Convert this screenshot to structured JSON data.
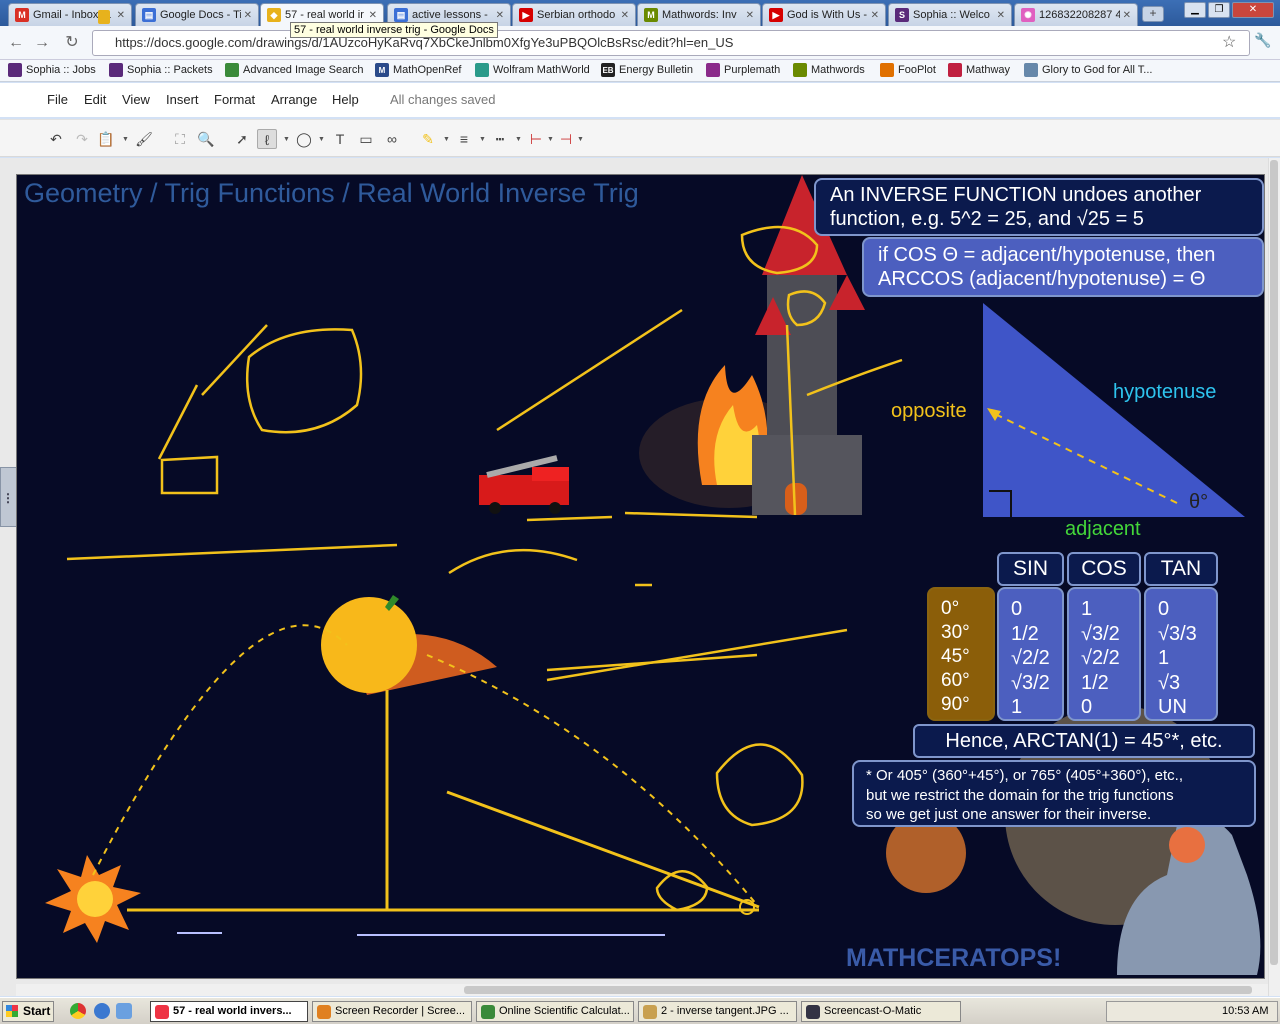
{
  "browser": {
    "tabs": [
      {
        "label": "Gmail - Inbox (1",
        "color": "#d93025",
        "glyph": "M"
      },
      {
        "label": "Google Docs - Ti",
        "color": "#3b6fd6",
        "glyph": "▤"
      },
      {
        "label": "57 - real world ir",
        "color": "#e8b21c",
        "glyph": "◆",
        "active": true
      },
      {
        "label": "active lessons -",
        "color": "#3b6fd6",
        "glyph": "▤"
      },
      {
        "label": "Serbian orthodo",
        "color": "#d60000",
        "glyph": "▶"
      },
      {
        "label": "Mathwords: Inv",
        "color": "#6a8a00",
        "glyph": "M"
      },
      {
        "label": "God is With Us -",
        "color": "#d60000",
        "glyph": "▶"
      },
      {
        "label": "Sophia :: Welco",
        "color": "#5a2a7a",
        "glyph": "S"
      },
      {
        "label": "126832208287 4",
        "color": "#e060c0",
        "glyph": "✺"
      }
    ],
    "new_tab": "+",
    "tooltip": "57 - real world inverse trig - Google Docs",
    "url": "https://docs.google.com/drawings/d/1AUzcoHyKaRvq7XbCkeJnlbm0XfgYe3uPBQOlcBsRsc/edit?hl=en_US",
    "bookmarks": [
      {
        "label": "Sophia :: Jobs",
        "color": "#5a2a7a"
      },
      {
        "label": "Sophia :: Packets",
        "color": "#5a2a7a"
      },
      {
        "label": "Advanced Image Search",
        "color": "#3a8a3a"
      },
      {
        "label": "MathOpenRef",
        "color": "#2a4a8a",
        "glyph": "M"
      },
      {
        "label": "Wolfram MathWorld",
        "color": "#2a9a8a"
      },
      {
        "label": "Energy Bulletin",
        "color": "#222222",
        "glyph": "EB"
      },
      {
        "label": "Purplemath",
        "color": "#8a2a8a"
      },
      {
        "label": "Mathwords",
        "color": "#6a8a00"
      },
      {
        "label": "FooPlot",
        "color": "#e07000"
      },
      {
        "label": "Mathway",
        "color": "#c02040"
      },
      {
        "label": "Glory to God for All T...",
        "color": "#6688aa"
      }
    ]
  },
  "docs": {
    "menu": [
      "File",
      "Edit",
      "View",
      "Insert",
      "Format",
      "Arrange",
      "Help"
    ],
    "status": "All changes saved"
  },
  "slide": {
    "title": "Geometry / Trig Functions / Real World Inverse Trig",
    "inverse_box": [
      "An INVERSE FUNCTION undoes another",
      "function, e.g. 5^2 = 25, and √25 = 5"
    ],
    "arccos_box": [
      "if COS Θ = adjacent/hypotenuse, then",
      "ARCCOS (adjacent/hypotenuse) = Θ"
    ],
    "triangle_labels": {
      "opposite": "opposite",
      "hypotenuse": "hypotenuse",
      "adjacent": "adjacent",
      "theta": "θ°"
    },
    "table": {
      "headers": [
        "SIN",
        "COS",
        "TAN"
      ],
      "angles": [
        "0°",
        "30°",
        "45°",
        "60°",
        "90°"
      ],
      "sin": [
        "0",
        "1/2",
        "√2/2",
        "√3/2",
        "1"
      ],
      "cos": [
        "1",
        "√3/2",
        "√2/2",
        "1/2",
        "0"
      ],
      "tan": [
        "0",
        "√3/3",
        "1",
        "√3",
        "UN"
      ]
    },
    "hence": "Hence, ARCTAN(1) = 45°*, etc.",
    "footnote": [
      "* Or 405° (360°+45°), or 765° (405°+360°), etc.,",
      "but we restrict the domain for the trig functions",
      "so we get just one answer for their inverse."
    ],
    "brand": "MATHCERATOPS!",
    "colors": {
      "background": "#060a26",
      "ink": "#f2c21b",
      "box_dark": "#0b1a4d",
      "box_light": "#4c5fbf",
      "triangle": "#3f55c8",
      "hypotenuse_label": "#2ec4ee",
      "adjacent_label": "#43d63a"
    }
  },
  "taskbar": {
    "start": "Start",
    "tasks": [
      {
        "label": "57 - real world invers...",
        "active": true
      },
      {
        "label": "Screen Recorder | Scree..."
      },
      {
        "label": "Online Scientific Calculat..."
      },
      {
        "label": "2 - inverse tangent.JPG ..."
      },
      {
        "label": "Screencast-O-Matic"
      }
    ],
    "clock": "10:53 AM"
  }
}
